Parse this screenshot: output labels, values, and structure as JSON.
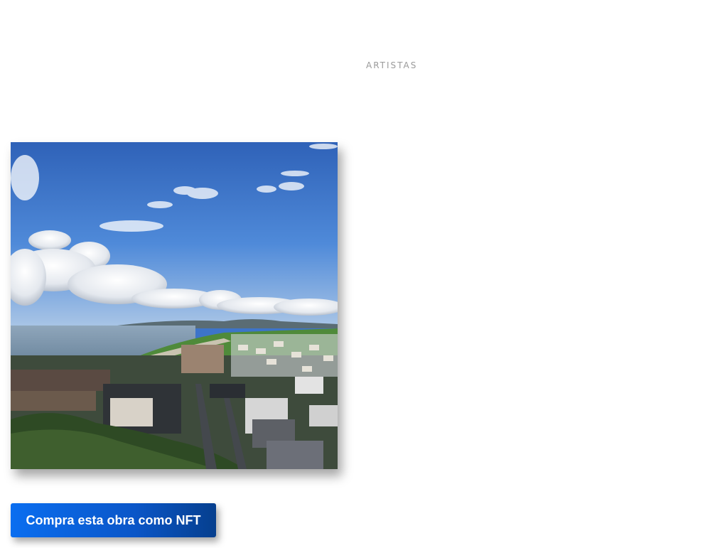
{
  "nav": {
    "artists_label": "ARTISTAS"
  },
  "artwork": {
    "subject": "coastal-town-photo"
  },
  "cta": {
    "buy_nft_label": "Compra esta obra como NFT"
  },
  "colors": {
    "accent": "#0a6ef0",
    "accent_dark": "#063f8e",
    "nav_text": "#9a9a9a",
    "background": "#ffffff"
  }
}
